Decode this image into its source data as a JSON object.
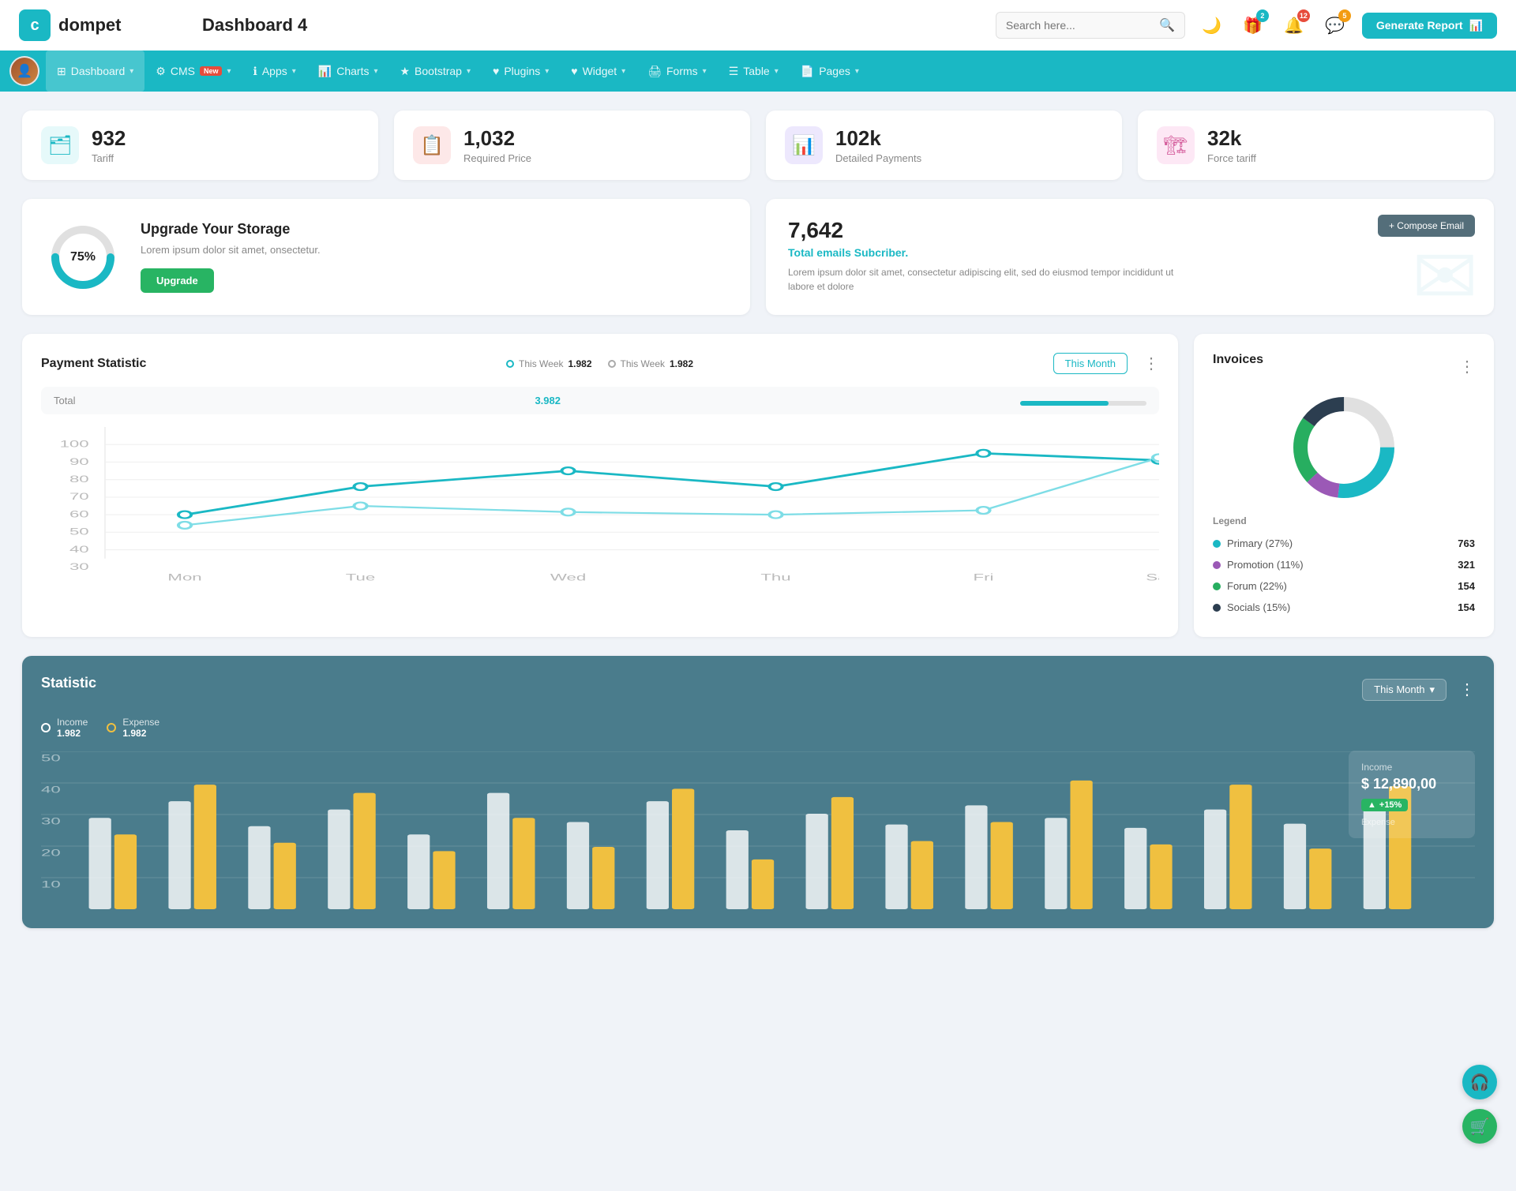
{
  "header": {
    "logo_text": "dompet",
    "app_title": "Dashboard 4",
    "search_placeholder": "Search here...",
    "generate_btn": "Generate Report",
    "icons": {
      "moon": "🌙",
      "gift": "🎁",
      "bell": "🔔",
      "chat": "💬"
    },
    "badges": {
      "gift": "2",
      "bell": "12",
      "chat": "5"
    }
  },
  "nav": {
    "items": [
      {
        "label": "Dashboard",
        "icon": "⊞",
        "active": true,
        "has_arrow": true
      },
      {
        "label": "CMS",
        "icon": "⚙",
        "has_badge": true,
        "badge_text": "New",
        "has_arrow": true
      },
      {
        "label": "Apps",
        "icon": "ℹ",
        "has_arrow": true
      },
      {
        "label": "Charts",
        "icon": "📊",
        "has_arrow": true
      },
      {
        "label": "Bootstrap",
        "icon": "★",
        "has_arrow": true
      },
      {
        "label": "Plugins",
        "icon": "♥",
        "has_arrow": true
      },
      {
        "label": "Widget",
        "icon": "♥",
        "has_arrow": true
      },
      {
        "label": "Forms",
        "icon": "🖨",
        "has_arrow": true
      },
      {
        "label": "Table",
        "icon": "☰",
        "has_arrow": true
      },
      {
        "label": "Pages",
        "icon": "📄",
        "has_arrow": true
      }
    ]
  },
  "stat_cards": [
    {
      "id": "tariff",
      "num": "932",
      "label": "Tariff",
      "icon_type": "teal",
      "icon": "🗂"
    },
    {
      "id": "required_price",
      "num": "1,032",
      "label": "Required Price",
      "icon_type": "red",
      "icon": "📋"
    },
    {
      "id": "detailed_payments",
      "num": "102k",
      "label": "Detailed Payments",
      "icon_type": "purple",
      "icon": "📊"
    },
    {
      "id": "force_tariff",
      "num": "32k",
      "label": "Force tariff",
      "icon_type": "pink",
      "icon": "🏗"
    }
  ],
  "storage": {
    "title": "Upgrade Your Storage",
    "desc": "Lorem ipsum dolor sit amet, onsectetur.",
    "percent": "75%",
    "btn_label": "Upgrade"
  },
  "email_card": {
    "num": "7,642",
    "sub_label": "Total emails Subcriber.",
    "desc": "Lorem ipsum dolor sit amet, consectetur adipiscing elit, sed do eiusmod tempor incididunt ut labore et dolore",
    "compose_btn": "+ Compose Email"
  },
  "payment_statistic": {
    "title": "Payment Statistic",
    "filter1_label": "This Week",
    "filter1_val": "1.982",
    "filter2_label": "This Week",
    "filter2_val": "1.982",
    "month_btn": "This Month",
    "total_label": "Total",
    "total_val": "3.982",
    "x_labels": [
      "Mon",
      "Tue",
      "Wed",
      "Thu",
      "Fri",
      "Sat"
    ],
    "y_labels": [
      "100",
      "90",
      "80",
      "70",
      "60",
      "50",
      "40",
      "30"
    ]
  },
  "invoices": {
    "title": "Invoices",
    "legend": [
      {
        "label": "Primary (27%)",
        "color": "#1ab8c4",
        "val": "763"
      },
      {
        "label": "Promotion (11%)",
        "color": "#9b59b6",
        "val": "321"
      },
      {
        "label": "Forum (22%)",
        "color": "#27ae60",
        "val": "154"
      },
      {
        "label": "Socials (15%)",
        "color": "#2c3e50",
        "val": "154"
      }
    ],
    "legend_header": "Legend"
  },
  "statistic": {
    "title": "Statistic",
    "month_btn": "This Month",
    "income_label": "Income",
    "income_val": "1.982",
    "expense_label": "Expense",
    "expense_val": "1.982",
    "income_box_label": "Income",
    "income_box_val": "$ 12,890,00",
    "income_badge": "+15%",
    "y_labels": [
      "50",
      "40",
      "30",
      "20",
      "10"
    ]
  },
  "fab": {
    "headset": "🎧",
    "cart": "🛒"
  }
}
